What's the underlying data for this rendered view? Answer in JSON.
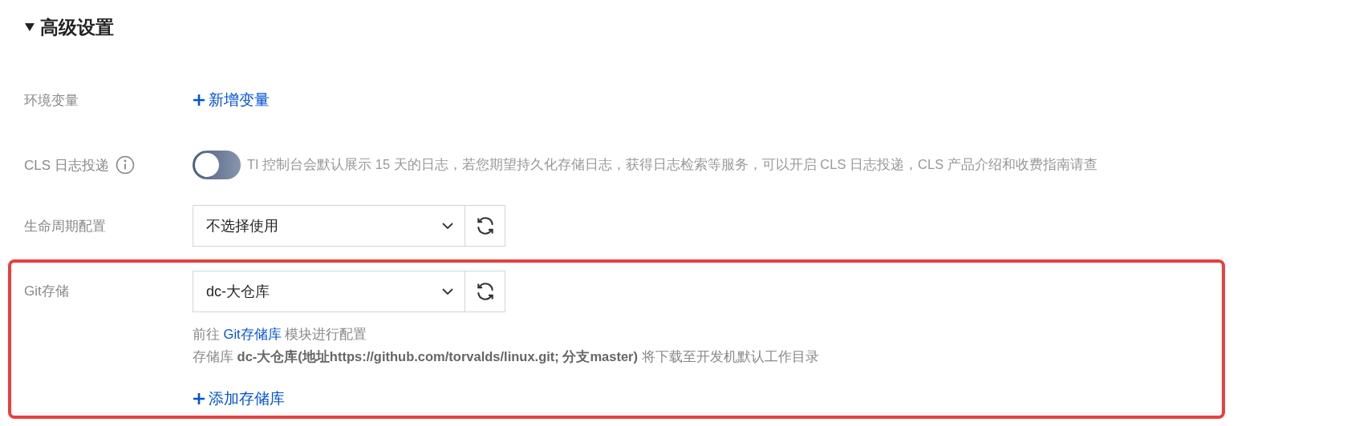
{
  "section": {
    "title": "高级设置",
    "expanded": true
  },
  "fields": [
    {
      "kind": "link",
      "label": "环境变量",
      "link": "新增变量"
    },
    {
      "kind": "toggle",
      "label": "CLS 日志投递",
      "info": true,
      "on": false,
      "description": "TI 控制台会默认展示 15 天的日志，若您期望持久化存储日志，获得日志检索等服务，可以开启 CLS 日志投递，CLS 产品介绍和收费指南请查"
    },
    {
      "kind": "select",
      "label": "生命周期配置",
      "value": "不选择使用",
      "highlighted": false
    },
    {
      "kind": "select",
      "label": "Git存储",
      "value": "dc-大仓库",
      "highlighted": true,
      "hint_prefix": "前往",
      "hint_link": "Git存储库",
      "hint_suffix": "模块进行配置",
      "detail": "存储库 **dc-大仓库(地址https://github.com/torvalds/linux.git; 分支master)** 将下载至开发机默认工作目录",
      "add_link": "添加存储库"
    }
  ]
}
